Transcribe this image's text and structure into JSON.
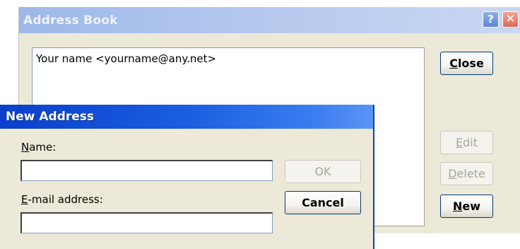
{
  "address_book": {
    "title": "Address Book",
    "help_glyph": "?",
    "close_glyph": "✕",
    "entries": [
      "Your name <yourname@any.net>"
    ],
    "buttons": {
      "close": {
        "hotkey": "C",
        "rest": "lose"
      },
      "edit": {
        "hotkey": "E",
        "rest": "dit"
      },
      "delete": {
        "hotkey": "D",
        "rest": "elete"
      },
      "new": {
        "hotkey": "N",
        "rest": "ew"
      }
    }
  },
  "new_address": {
    "title": "New Address",
    "name_label": {
      "hotkey": "N",
      "rest": "ame:"
    },
    "name_value": "",
    "email_label": {
      "hotkey": "E",
      "rest": "-mail address:"
    },
    "email_value": "",
    "ok_label": "OK",
    "cancel_label": "Cancel"
  },
  "icons": {
    "help": "help-icon",
    "close": "close-icon"
  }
}
